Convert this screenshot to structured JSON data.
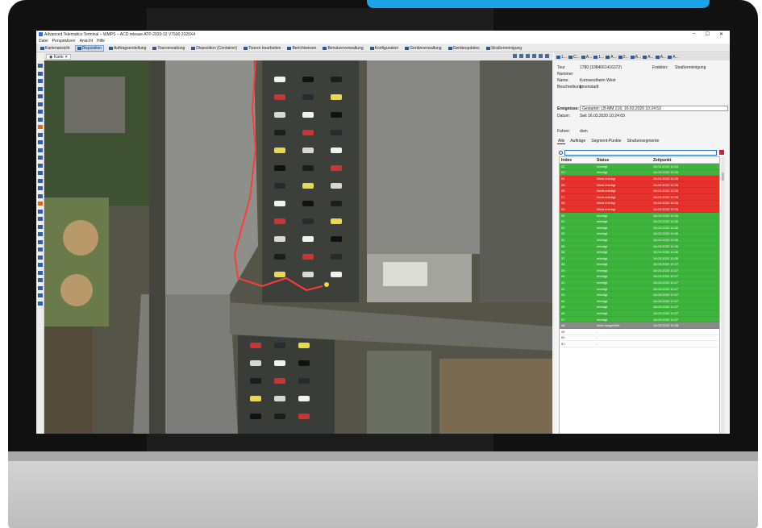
{
  "window": {
    "title": "Advanced Telematics Terminal – WMPS – ACD release ATP-2020-12 V7500 2020X4",
    "controls": [
      "–",
      "☐",
      "✕"
    ]
  },
  "menu": [
    "Datei",
    "Perspektiven",
    "Ansicht",
    "Hilfe"
  ],
  "toolbar": [
    {
      "label": "Kartenansicht",
      "active": false
    },
    {
      "label": "Disposition",
      "active": true
    },
    {
      "label": "Auftragserstellung",
      "active": false
    },
    {
      "label": "Tourverwaltung",
      "active": false
    },
    {
      "label": "Disposition (Container)",
      "active": false
    },
    {
      "label": "Touren bearbeiten",
      "active": false
    },
    {
      "label": "Berichtwesen",
      "active": false
    },
    {
      "label": "Benutzerverwaltung",
      "active": false
    },
    {
      "label": "Konfiguration",
      "active": false
    },
    {
      "label": "Geräteverwaltung",
      "active": false
    },
    {
      "label": "Geräteupdates",
      "active": false
    },
    {
      "label": "Straßenreinigung",
      "active": false
    }
  ],
  "map_tab": {
    "label": "Karte",
    "close": "✕"
  },
  "right_tabs": [
    "1...",
    "C...",
    "A...",
    "1...",
    "A...",
    "2...",
    "A...",
    "A...",
    "A...",
    "A..."
  ],
  "tour_info": {
    "tour_nummer_label": "Tour Nummer:",
    "tour_nummer_value": "1780 (1084061416372)",
    "fraktion_label": "Fraktion:",
    "fraktion_value": "Straßenreinigung",
    "name_label": "Name:",
    "name_value": "Kornwestheim West",
    "beschreibung_label": "Beschreibung:",
    "beschreibung_value": "Innenstadt"
  },
  "ereignisse": {
    "label": "Ereignisse:",
    "value": "Gestartet: LB-MM 216: 16.03.2020 10:24:53",
    "datum_label": "Datum:",
    "datum_value": "Seit 16.03.2020 10:24:03"
  },
  "fahrer": {
    "label": "Fahrer:",
    "value": "dom"
  },
  "subtabs": [
    {
      "label": "Alle",
      "on": true
    },
    {
      "label": "Aufträge",
      "on": false
    },
    {
      "label": "Segment-Punkte",
      "on": false
    },
    {
      "label": "Straßensegmente",
      "on": false
    }
  ],
  "table": {
    "headers": [
      "Index",
      "Status",
      "Zeitpunkt"
    ],
    "rows": [
      {
        "index": "22",
        "status": "erledigt",
        "time": "16.03.2020 10:24",
        "color": "#3db53d"
      },
      {
        "index": "23",
        "status": "erledigt",
        "time": "16.03.2020 10:25",
        "color": "#3db53d"
      },
      {
        "index": "24",
        "status": "Nicht erledigt",
        "time": "16.03.2020 10:25",
        "color": "#e8312c"
      },
      {
        "index": "25",
        "status": "Nicht erledigt",
        "time": "16.03.2020 10:25",
        "color": "#e8312c"
      },
      {
        "index": "26",
        "status": "Nicht erledigt",
        "time": "16.03.2020 10:25",
        "color": "#e8312c"
      },
      {
        "index": "27",
        "status": "Nicht erledigt",
        "time": "16.03.2020 10:25",
        "color": "#e8312c"
      },
      {
        "index": "28",
        "status": "Nicht erledigt",
        "time": "16.03.2020 10:25",
        "color": "#e8312c"
      },
      {
        "index": "29",
        "status": "Nicht erledigt",
        "time": "16.03.2020 10:25",
        "color": "#e8312c"
      },
      {
        "index": "30",
        "status": "erledigt",
        "time": "16.03.2020 10:26",
        "color": "#3db53d"
      },
      {
        "index": "31",
        "status": "erledigt",
        "time": "16.03.2020 10:26",
        "color": "#3db53d"
      },
      {
        "index": "32",
        "status": "erledigt",
        "time": "16.03.2020 10:26",
        "color": "#3db53d"
      },
      {
        "index": "33",
        "status": "erledigt",
        "time": "16.03.2020 10:26",
        "color": "#3db53d"
      },
      {
        "index": "34",
        "status": "erledigt",
        "time": "16.03.2020 10:26",
        "color": "#3db53d"
      },
      {
        "index": "35",
        "status": "erledigt",
        "time": "16.03.2020 10:26",
        "color": "#3db53d"
      },
      {
        "index": "36",
        "status": "erledigt",
        "time": "16.03.2020 10:26",
        "color": "#3db53d"
      },
      {
        "index": "37",
        "status": "erledigt",
        "time": "16.03.2020 10:26",
        "color": "#3db53d"
      },
      {
        "index": "38",
        "status": "erledigt",
        "time": "16.03.2020 10:27",
        "color": "#3db53d"
      },
      {
        "index": "39",
        "status": "erledigt",
        "time": "16.03.2020 10:27",
        "color": "#3db53d"
      },
      {
        "index": "40",
        "status": "erledigt",
        "time": "16.03.2020 10:27",
        "color": "#3db53d"
      },
      {
        "index": "41",
        "status": "erledigt",
        "time": "16.03.2020 10:27",
        "color": "#3db53d"
      },
      {
        "index": "42",
        "status": "erledigt",
        "time": "16.03.2020 10:27",
        "color": "#3db53d"
      },
      {
        "index": "43",
        "status": "erledigt",
        "time": "16.03.2020 10:27",
        "color": "#3db53d"
      },
      {
        "index": "44",
        "status": "erledigt",
        "time": "16.03.2020 10:27",
        "color": "#3db53d"
      },
      {
        "index": "45",
        "status": "erledigt",
        "time": "16.03.2020 10:27",
        "color": "#3db53d"
      },
      {
        "index": "46",
        "status": "erledigt",
        "time": "16.03.2020 10:27",
        "color": "#3db53d"
      },
      {
        "index": "47",
        "status": "erledigt",
        "time": "16.03.2020 10:27",
        "color": "#3db53d"
      },
      {
        "index": "48",
        "status": "nicht ausgeführt",
        "time": "16.03.2020 10:28",
        "color": "#8a8a8a"
      },
      {
        "index": "49",
        "status": "-",
        "time": "",
        "color": "#ffffff"
      },
      {
        "index": "50",
        "status": "-",
        "time": "",
        "color": "#ffffff"
      },
      {
        "index": "51",
        "status": "-",
        "time": "",
        "color": "#ffffff"
      }
    ]
  },
  "colors": {
    "accent": "#1aa3e8",
    "done": "#3db53d",
    "not_done": "#e8312c",
    "skipped": "#8a8a8a",
    "route": "#ff3b3b"
  }
}
